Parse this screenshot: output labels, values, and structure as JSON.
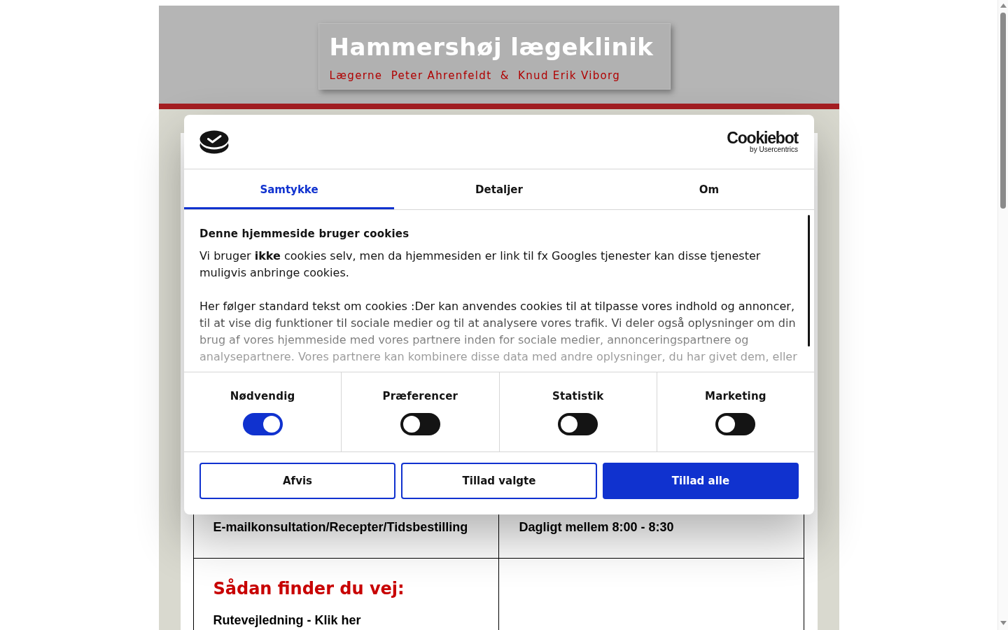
{
  "site_header": {
    "title": "Hammershøj lægeklinik",
    "subtitle": "Lægerne  Peter Ahrenfeldt  &  Knud Erik Viborg"
  },
  "cookie_dialog": {
    "brand": "Cookiebot",
    "brand_byline": "by Usercentrics",
    "tabs": [
      {
        "label": "Samtykke",
        "selected": true
      },
      {
        "label": "Detaljer",
        "selected": false
      },
      {
        "label": "Om",
        "selected": false
      }
    ],
    "heading": "Denne hjemmeside bruger cookies",
    "paragraphs": [
      "Vi bruger **ikke** cookies selv, men da hjemmesiden er link til fx Googles tjenester kan disse tjenester muligvis anbringe cookies.",
      "Her følger standard tekst om cookies :Der kan anvendes cookies til at tilpasse vores indhold og annoncer, til at vise dig funktioner til sociale medier og til at analysere vores trafik. Vi deler også oplysninger om din brug af vores hjemmeside med vores partnere inden for sociale medier, annonceringspartnere og analysepartnere. Vores partnere kan kombinere disse data med andre oplysninger, du har givet dem, eller"
    ],
    "categories": [
      {
        "label": "Nødvendig",
        "checked": true
      },
      {
        "label": "Præferencer",
        "checked": false
      },
      {
        "label": "Statistik",
        "checked": false
      },
      {
        "label": "Marketing",
        "checked": false
      }
    ],
    "buttons": [
      {
        "label": "Afvis",
        "kind": "outline"
      },
      {
        "label": "Tillad valgte",
        "kind": "outline"
      },
      {
        "label": "Tillad alle",
        "kind": "primary"
      }
    ]
  },
  "schedule_row": {
    "service": "E-mailkonsultation/Recepter/Tidsbestilling",
    "hours": "Dagligt mellem 8:00 - 8:30"
  },
  "directions": {
    "heading": "Sådan finder du vej:",
    "link": "Rutevejledning - Klik her"
  }
}
